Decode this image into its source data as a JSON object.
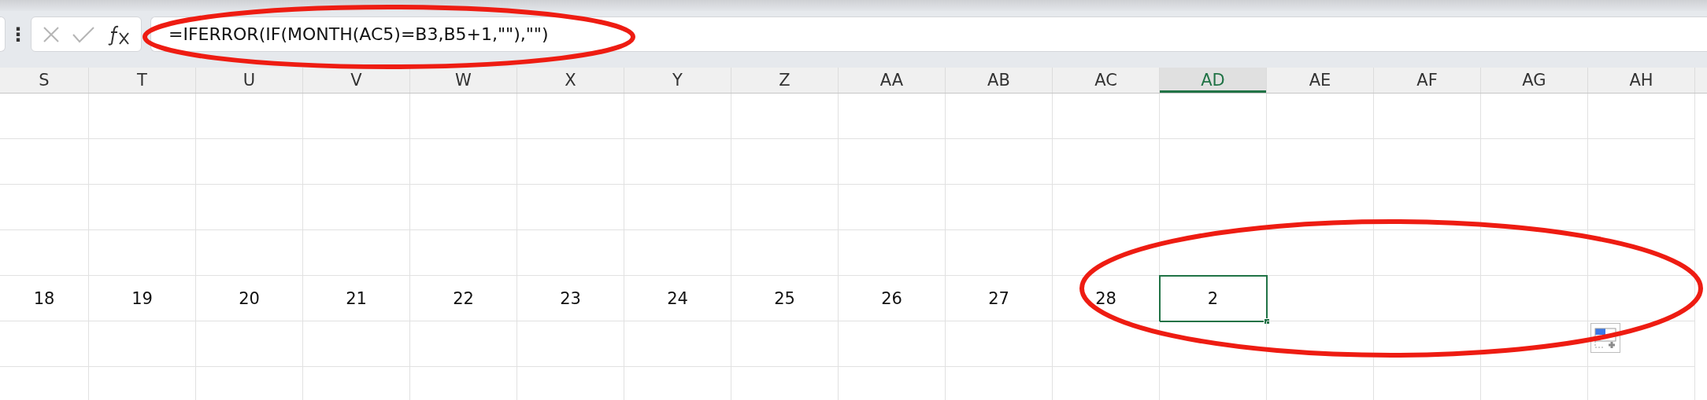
{
  "formula_bar": {
    "more_icon": "⋮",
    "formula": "=IFERROR(IF(MONTH(AC5)=B3,B5+1,\"\"),\"\")"
  },
  "columns": [
    {
      "label": "S",
      "selected": false
    },
    {
      "label": "T",
      "selected": false
    },
    {
      "label": "U",
      "selected": false
    },
    {
      "label": "V",
      "selected": false
    },
    {
      "label": "W",
      "selected": false
    },
    {
      "label": "X",
      "selected": false
    },
    {
      "label": "Y",
      "selected": false
    },
    {
      "label": "Z",
      "selected": false
    },
    {
      "label": "AA",
      "selected": false
    },
    {
      "label": "AB",
      "selected": false
    },
    {
      "label": "AC",
      "selected": false
    },
    {
      "label": "AD",
      "selected": true
    },
    {
      "label": "AE",
      "selected": false
    },
    {
      "label": "AF",
      "selected": false
    },
    {
      "label": "AG",
      "selected": false
    },
    {
      "label": "AH",
      "selected": false
    }
  ],
  "data_row": [
    {
      "value": "18",
      "selected": false
    },
    {
      "value": "19",
      "selected": false
    },
    {
      "value": "20",
      "selected": false
    },
    {
      "value": "21",
      "selected": false
    },
    {
      "value": "22",
      "selected": false
    },
    {
      "value": "23",
      "selected": false
    },
    {
      "value": "24",
      "selected": false
    },
    {
      "value": "25",
      "selected": false
    },
    {
      "value": "26",
      "selected": false
    },
    {
      "value": "27",
      "selected": false
    },
    {
      "value": "28",
      "selected": false
    },
    {
      "value": "2",
      "selected": true
    }
  ]
}
